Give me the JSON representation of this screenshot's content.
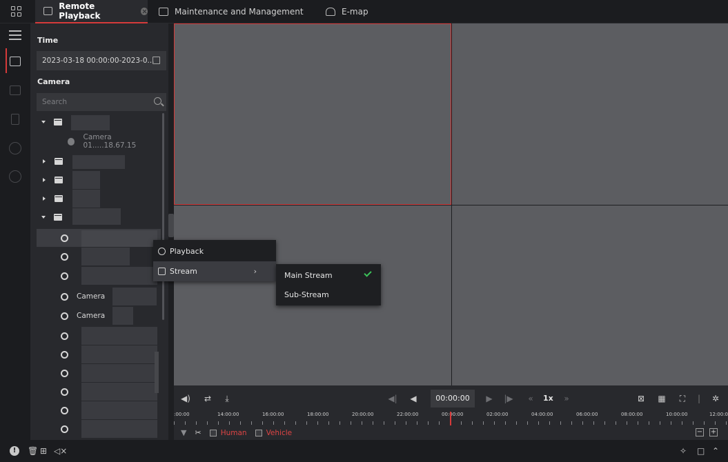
{
  "tabs": [
    {
      "label": "Remote Playback",
      "active": true
    },
    {
      "label": "Maintenance and Management",
      "active": false
    },
    {
      "label": "E-map",
      "active": false
    }
  ],
  "panel": {
    "time_label": "Time",
    "time_value": "2023-03-18 00:00:00-2023-0...",
    "camera_label": "Camera",
    "search_placeholder": "Search",
    "camera_item": "Camera 01.....18.67.15",
    "camera_a": "Camera",
    "camera_b": "Camera"
  },
  "context_menu": {
    "playback": "Playback",
    "stream": "Stream",
    "stream_options": [
      "Main Stream",
      "Sub-Stream"
    ],
    "selected_stream": "Main Stream"
  },
  "controls": {
    "current_time": "00:00:00",
    "speed": "1x",
    "timeline_labels": [
      ":00:00",
      "14:00:00",
      "16:00:00",
      "18:00:00",
      "20:00:00",
      "22:00:00",
      "00:00:00",
      "02:00:00",
      "04:00:00",
      "06:00:00",
      "08:00:00",
      "10:00:00",
      "12:00:0"
    ]
  },
  "filters": {
    "human": "Human",
    "vehicle": "Vehicle"
  },
  "colors": {
    "accent": "#d63a3a",
    "check": "#3cc25a",
    "filter_text": "#dd4444"
  }
}
